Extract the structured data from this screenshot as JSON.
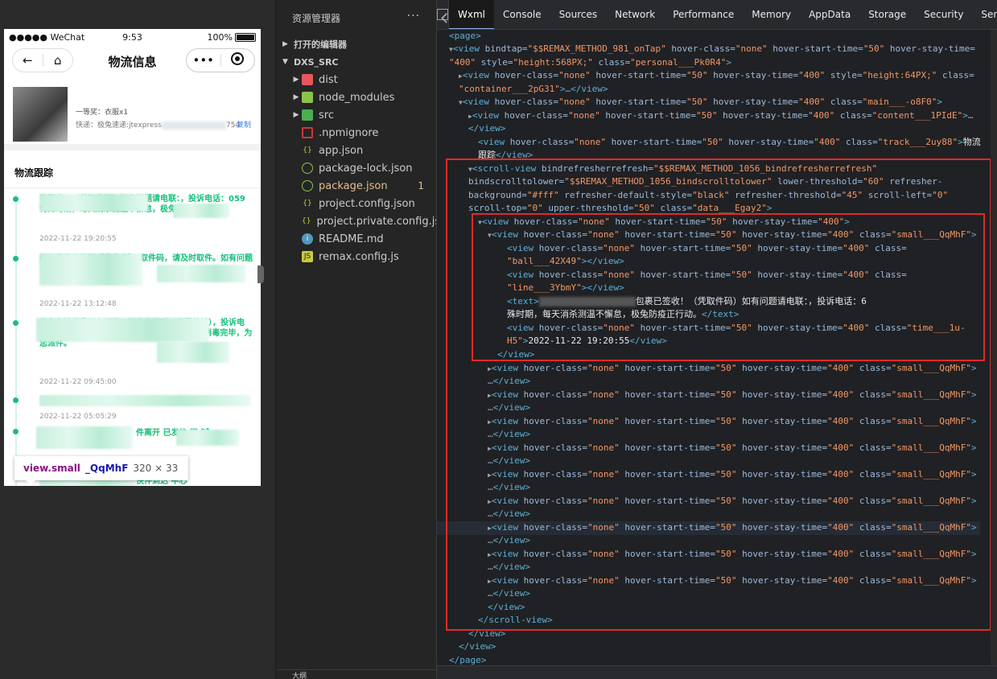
{
  "simulator": {
    "carrier": "●●●●● WeChat",
    "time": "9:53",
    "battery": "100%",
    "title": "物流信息",
    "prize": "一等奖：衣服x1",
    "express_prefix": "快递：极兔速递:jtexpress",
    "express_suffix": "754",
    "copy": "复制",
    "track_title": "物流跟踪",
    "tracks": [
      {
        "text": "已签收！（凭取件码）如有问题请电联：，投诉电话：059 特殊时期，每天消杀测温不懈怠，极兔防疫正行动。",
        "time": "2022-11-22 19:20:55"
      },
      {
        "text": "的包裹已存放至【代收点】，取件码，请及时取件。如有问题请联系，投诉电话：05",
        "time": "2022-11-22 13:12:48"
      },
      {
        "text": "的兔兔快递员正在派件，可放心接听（专属热线），投诉电话：059 今天的兔兔，体温正常，口罩戴好，消毒完毕，为您派件。",
        "time": "2022-11-22 09:45:00"
      },
      {
        "text": "",
        "time": "2022-11-22 05:05:29"
      },
      {
        "text": "件离开 已发往 网点】",
        "time": ""
      },
      {
        "text": "快件到达 中心",
        "time": ""
      }
    ],
    "tooltip": {
      "tag": "view.small",
      "cls": "_QqMhF",
      "dim": "320 × 33"
    }
  },
  "explorer": {
    "title": "资源管理器",
    "more": "···",
    "open_editors": "打开的编辑器",
    "root": "DXS_SRC",
    "footer": "大纲",
    "files": [
      {
        "name": "dist",
        "icon": "folder-icon",
        "folder": true
      },
      {
        "name": "node_modules",
        "icon": "node-folder-icon",
        "folder": true
      },
      {
        "name": "src",
        "icon": "src-folder-icon",
        "folder": true
      },
      {
        "name": ".npmignore",
        "icon": "npm-icon"
      },
      {
        "name": "app.json",
        "icon": "json-icon"
      },
      {
        "name": "package-lock.json",
        "icon": "node-file-icon"
      },
      {
        "name": "package.json",
        "icon": "node-file-icon",
        "modified": true,
        "badge": "1"
      },
      {
        "name": "project.config.json",
        "icon": "json-icon"
      },
      {
        "name": "project.private.config.js...",
        "icon": "json-icon"
      },
      {
        "name": "README.md",
        "icon": "info-icon"
      },
      {
        "name": "remax.config.js",
        "icon": "js-icon"
      }
    ]
  },
  "devtools": {
    "tabs": [
      "Wxml",
      "Console",
      "Sources",
      "Network",
      "Performance",
      "Memory",
      "AppData",
      "Storage",
      "Security",
      "Sens"
    ],
    "active_tab": "Wxml",
    "text_content_visible": "包裹已签收！（凭取件码）如有问题请电联：，投诉电话：6",
    "text_content_line2": "殊时期，每天消杀测温不懈怠，极兔防疫正行动。",
    "time_content": "2022-11-22 19:20:55"
  },
  "colors": {
    "accent": "#16c07a",
    "highlight_box": "#e02a2a",
    "tag": "#5db0d7",
    "attr_value": "#f29766"
  }
}
